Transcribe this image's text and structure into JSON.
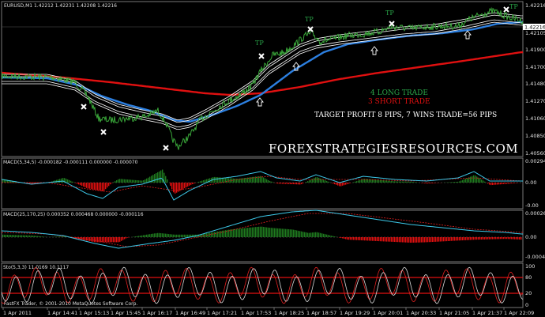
{
  "header": {
    "symbol_line": "EURUSD,M1  1.42212 1.42231 1.42208 1.42216"
  },
  "annotations": {
    "tp_label": "TP",
    "tp_marks": 4,
    "long_trade": "4 LONG TRADE",
    "short_trade": "3 SHORT TRADE",
    "target_profit": "TARGET PROFIT 8 PIPS, 7 WINS TRADE=56 PIPS",
    "watermark": "FOREXSTRATEGIESRESOURCES.COM"
  },
  "price_axis": {
    "ticks": [
      "1.42216",
      "1.42105",
      "1.41900",
      "1.41700",
      "1.41480",
      "1.41270",
      "1.41060",
      "1.40850",
      "1.40640",
      "1.40560"
    ],
    "current": "1.42216"
  },
  "panels": {
    "macd1": {
      "label": "MACD(5,34,5)  -0.000182 -0.000111 0.000000 -0.000070",
      "ticks": [
        "0.00294",
        "0.00",
        "-0.00"
      ]
    },
    "macd2": {
      "label": "MACD(25,170,25)  0.000352 0.000468 0.000000 -0.000116",
      "ticks": [
        "0.00026",
        "0.00",
        "-0.00041"
      ]
    },
    "stoch": {
      "label": "Sto(5,3,3)  11.0169 10.1117",
      "ticks": [
        "100",
        "80",
        "20",
        "0"
      ]
    }
  },
  "time_axis": [
    "1 Apr 2011",
    "1 Apr 14:41",
    "1 Apr 15:13",
    "1 Apr 15:45",
    "1 Apr 16:17",
    "1 Apr 16:49",
    "1 Apr 17:21",
    "1 Apr 17:53",
    "1 Apr 18:25",
    "1 Apr 18:57",
    "1 Apr 19:29",
    "1 Apr 20:01",
    "1 Apr 20:33",
    "1 Apr 21:05",
    "1 Apr 21:37",
    "1 Apr 22:09"
  ],
  "footer": {
    "copyright": "FastFX Trader, © 2001-2010 MetaQuotes Software Corp."
  },
  "colors": {
    "price": "#3aa83a",
    "ma_slow": "#e01010",
    "ma_mid": "#2c7fe0",
    "envelope": "#ffffff",
    "long_text": "#2aa84a",
    "short_text": "#e01010",
    "macd_line": "#3cc8e8",
    "signal_line": "#e02020",
    "hist_pos": "#1f7a1f",
    "hist_neg": "#e01010"
  }
}
